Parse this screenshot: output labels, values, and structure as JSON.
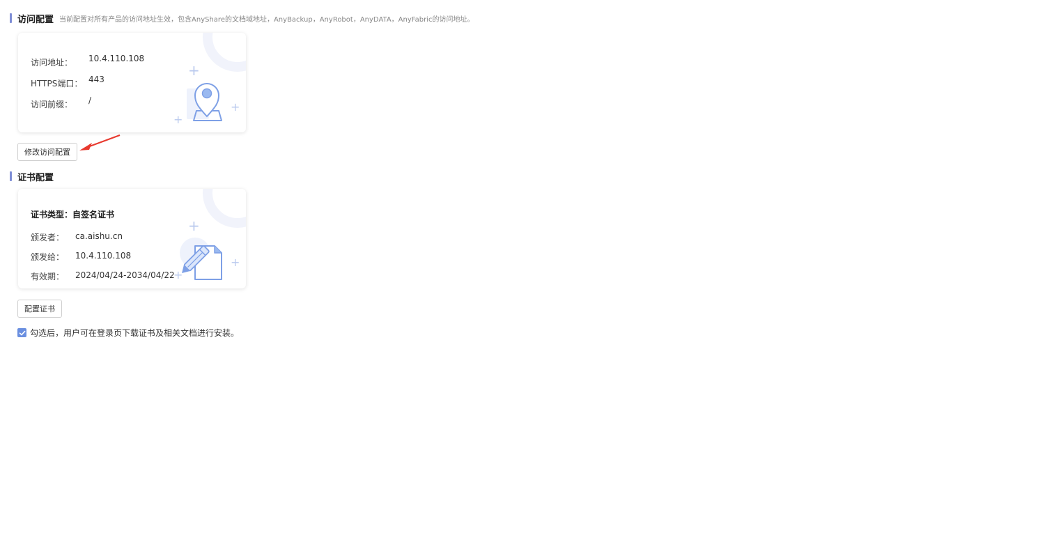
{
  "access": {
    "title": "访问配置",
    "description": "当前配置对所有产品的访问地址生效，包含AnyShare的文档域地址，AnyBackup，AnyRobot，AnyDATA，AnyFabric的访问地址。",
    "rows": [
      {
        "label": "访问地址：",
        "value": "10.4.110.108"
      },
      {
        "label": "HTTPS端口：",
        "value": "443"
      },
      {
        "label": "访问前缀：",
        "value": "/"
      }
    ],
    "edit_button": "修改访问配置",
    "icon": "location-pin-icon"
  },
  "cert": {
    "title": "证书配置",
    "type_label": "证书类型：",
    "type_value": "自签名证书",
    "rows": [
      {
        "label": "颁发者：",
        "value": "ca.aishu.cn"
      },
      {
        "label": "颁发给：",
        "value": "10.4.110.108"
      },
      {
        "label": "有效期：",
        "value": "2024/04/24-2034/04/22"
      }
    ],
    "config_button": "配置证书",
    "icon": "document-pen-icon"
  },
  "download_option": {
    "checked": true,
    "label": "勾选后，用户可在登录页下载证书及相关文档进行安装。"
  },
  "colors": {
    "accent": "#7e8ed6",
    "checkbox": "#6a8fe0",
    "arrow": "#e8392e"
  }
}
